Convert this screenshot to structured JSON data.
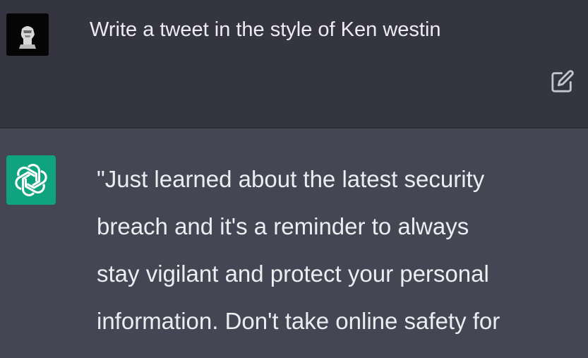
{
  "user_message": {
    "avatar_icon": "user-portrait-icon",
    "text": "Write a tweet in the style of Ken westin",
    "edit_icon": "edit-icon"
  },
  "assistant_message": {
    "avatar_icon": "openai-logo-icon",
    "lines": [
      "\"Just learned about the latest security",
      "breach and it's a reminder to always",
      "stay vigilant and protect your personal",
      "information. Don't take online safety for"
    ]
  },
  "colors": {
    "user_bg": "#343541",
    "assistant_bg": "#444654",
    "text": "#ECECF1",
    "brand": "#10A37F"
  }
}
